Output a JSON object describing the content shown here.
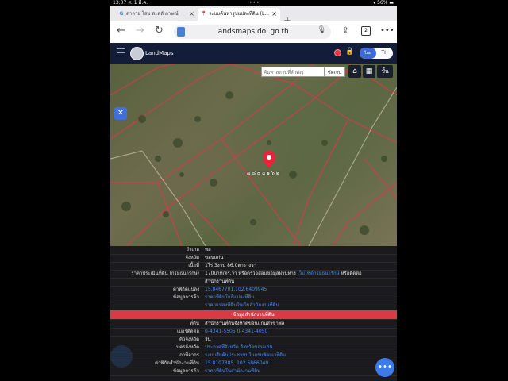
{
  "status": {
    "time": "13:07",
    "date": "ส. 1 มี.ค.",
    "dots": "•••",
    "battery": "56%"
  },
  "tabs": [
    {
      "icon": "G",
      "label": "ดาลาย โสม สะดลั ภาษณ์",
      "active": false
    },
    {
      "icon": "📍",
      "label": "ระบบค้นหารูปแปลงที่ดิน (L...",
      "active": true
    }
  ],
  "browser": {
    "url": "landsmaps.dol.go.th",
    "tab_count": "2",
    "more": "•••"
  },
  "app": {
    "name": "LandMaps",
    "lang_thai": "ไทย",
    "lang_th": "TH"
  },
  "map": {
    "search_placeholder": "ค้นหาสถานที่สำคัญ",
    "search_button": "ชัดเจน",
    "layer_button": "ชั้น",
    "pin_label": "๗ ๘ ๙ ๓ ๑ ๖ ๒"
  },
  "details": [
    {
      "label": "อำเภอ",
      "value": "พล"
    },
    {
      "label": "จังหวัด",
      "value": "ขอนแก่น"
    },
    {
      "label": "เนื้อที่",
      "value": "1ไร่ 3งาน 86.0ตารางวา"
    },
    {
      "label": "ราคาประเมินที่ดิน (กรมธนารักษ์)",
      "value": "170บาท/ตร.วา หรือตรวจสอบข้อมูลผ่านทาง",
      "value_link": "เว็บไซต์กรมธนารักษ์",
      "value_tail": "หรือติดต่อ"
    },
    {
      "label": "",
      "value": "สำนักงานที่ดิน"
    },
    {
      "label": "ค่าพิกัดแปลง",
      "value": "15.8467701,102.6409945",
      "link": true
    },
    {
      "label": "ข้อมูลการค้า",
      "value": "ราคาที่ดินใกล้แปลงที่ดิน",
      "link": true
    },
    {
      "label": "",
      "value": "ราคาแปลงที่ดินในเว็บสำนักงานที่ดิน",
      "link": true
    }
  ],
  "office_header": "ข้อมูลสำนักงานที่ดิน",
  "office": [
    {
      "label": "ที่ดิน",
      "value": "สำนักงานที่ดินจังหวัดขอนแก่นสาขาพล"
    },
    {
      "label": "เบอร์ติดต่อ",
      "value": "0-4341-5505 0-4341-4050",
      "link": true
    },
    {
      "label": "คิวจังหวัด",
      "value": "วัน"
    },
    {
      "label": "นครจังหวัด",
      "value": "ประกาศที่จังหวัด จังหวัดขอนแก่น",
      "link": true
    },
    {
      "label": "ภาษีอากร",
      "value": "ระบบสืบค้นประชาชนในกรมพัฒนาที่ดิน",
      "link": true
    },
    {
      "label": "ค่าพิกัดสำนักงานที่ดิน",
      "value": "15.8107385, 102.5866040",
      "link": true
    },
    {
      "label": "ข้อมูลการค้า",
      "value": "ราคาที่ดินในสำนักงานที่ดิน",
      "link": true
    }
  ]
}
